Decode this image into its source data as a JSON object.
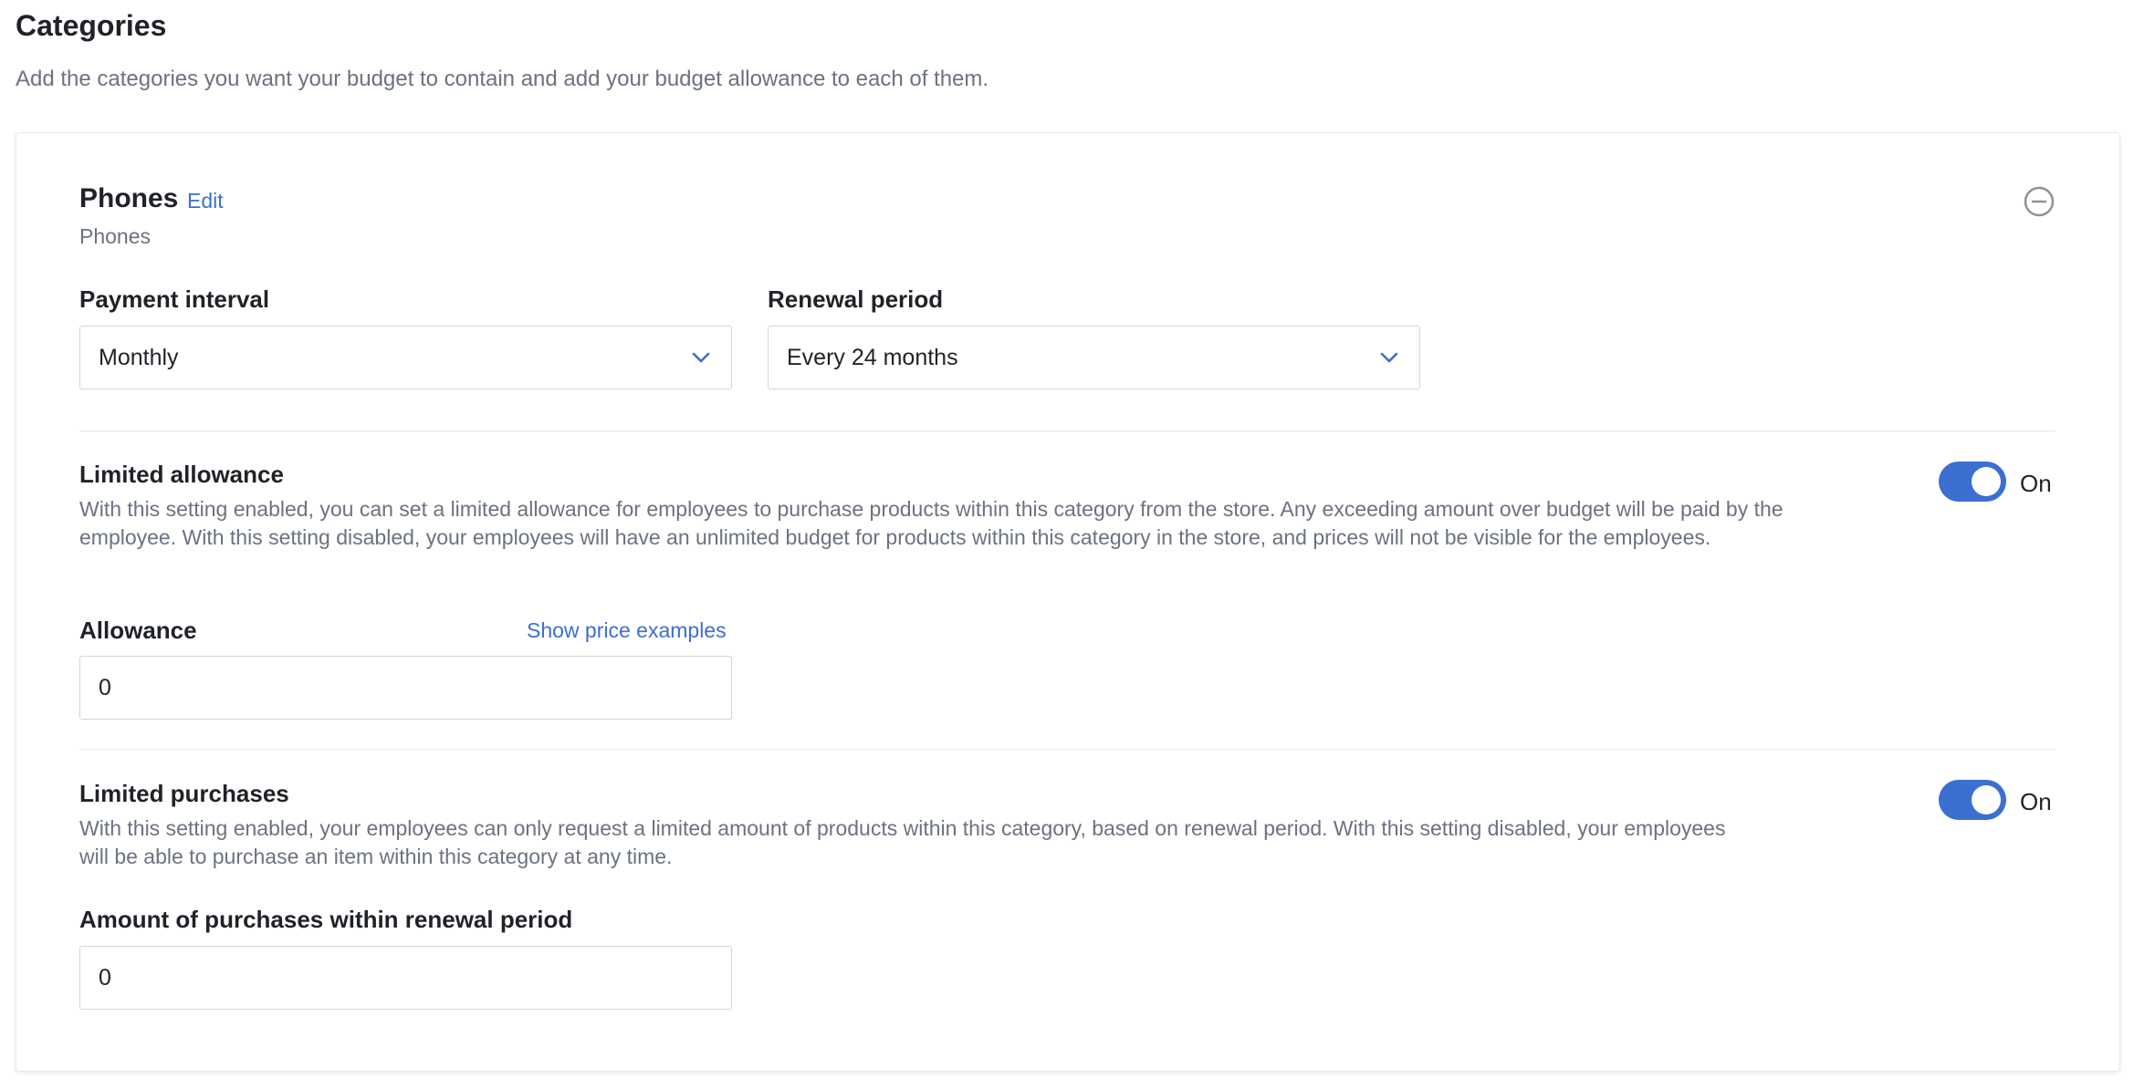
{
  "page": {
    "title": "Categories",
    "description": "Add the categories you want your budget to contain and add your budget allowance to each of them."
  },
  "category": {
    "name": "Phones",
    "edit_label": "Edit",
    "subtitle": "Phones",
    "remove_icon": "minus-circle-icon"
  },
  "payment_interval": {
    "label": "Payment interval",
    "value": "Monthly"
  },
  "renewal_period": {
    "label": "Renewal period",
    "value": "Every 24 months"
  },
  "limited_allowance": {
    "title": "Limited allowance",
    "description": "With this setting enabled, you can set a limited allowance for employees to purchase products within this category from the store. Any exceeding amount over budget will be paid by the employee. With this setting disabled, your employees will have an unlimited budget for products within this category in the store, and prices will not be visible for the employees.",
    "toggle_state": "On",
    "allowance_label": "Allowance",
    "show_examples_label": "Show price examples",
    "allowance_value": "0"
  },
  "limited_purchases": {
    "title": "Limited purchases",
    "description": "With this setting enabled, your employees can only request a limited amount of products within this category, based on renewal period. With this setting disabled, your employees will be able to purchase an item within this category at any time.",
    "toggle_state": "On",
    "amount_label": "Amount of purchases within renewal period",
    "amount_value": "0"
  },
  "colors": {
    "accent": "#3b6fd1",
    "muted_text": "#6b7280",
    "border": "#d1d5db"
  }
}
